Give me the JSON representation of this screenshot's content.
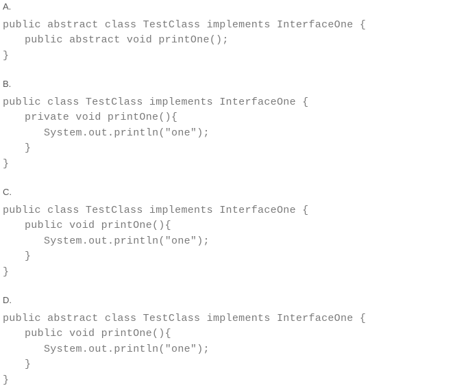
{
  "options": [
    {
      "label": "A.",
      "lines": [
        {
          "indent": 0,
          "text": "public abstract class TestClass implements InterfaceOne {"
        },
        {
          "indent": 1,
          "text": "public abstract void printOne();"
        },
        {
          "indent": 0,
          "text": "}"
        }
      ]
    },
    {
      "label": "B.",
      "lines": [
        {
          "indent": 0,
          "text": "public class TestClass implements InterfaceOne {"
        },
        {
          "indent": 1,
          "text": "private void printOne(){"
        },
        {
          "indent": 2,
          "text": "System.out.println(\"one\");"
        },
        {
          "indent": 1,
          "text": "}"
        },
        {
          "indent": 0,
          "text": "}"
        }
      ]
    },
    {
      "label": "C.",
      "lines": [
        {
          "indent": 0,
          "text": "public class TestClass implements InterfaceOne {"
        },
        {
          "indent": 1,
          "text": "public void printOne(){"
        },
        {
          "indent": 2,
          "text": "System.out.println(\"one\");"
        },
        {
          "indent": 1,
          "text": "}"
        },
        {
          "indent": 0,
          "text": "}"
        }
      ]
    },
    {
      "label": "D.",
      "lines": [
        {
          "indent": 0,
          "text": "public abstract class TestClass implements InterfaceOne {"
        },
        {
          "indent": 1,
          "text": "public void printOne(){"
        },
        {
          "indent": 2,
          "text": "System.out.println(\"one\");"
        },
        {
          "indent": 1,
          "text": "}"
        },
        {
          "indent": 0,
          "text": "}"
        }
      ]
    }
  ]
}
